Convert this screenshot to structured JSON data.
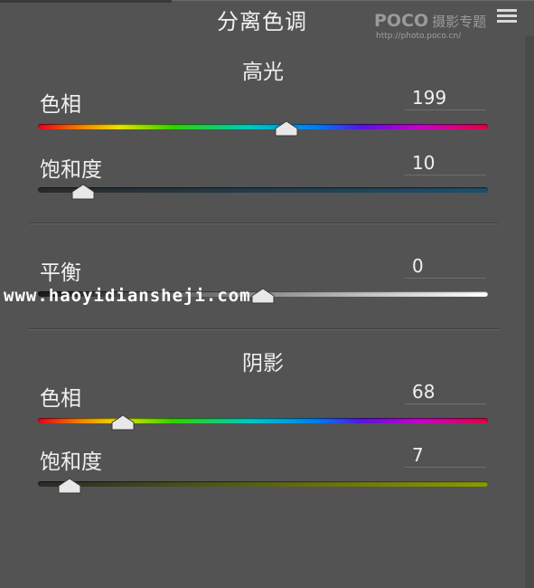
{
  "panel": {
    "title": "分离色调"
  },
  "watermark": {
    "brand": "POCO",
    "brand_sub": "摄影专题",
    "url": "http://photo.poco.cn/",
    "site": "www.haoyidiansheji.com"
  },
  "highlights": {
    "title": "高光",
    "hue": {
      "label": "色相",
      "value": "199",
      "fraction": 0.553
    },
    "saturation": {
      "label": "饱和度",
      "value": "10",
      "fraction": 0.1
    }
  },
  "balance": {
    "label": "平衡",
    "value": "0",
    "fraction": 0.5
  },
  "shadows": {
    "title": "阴影",
    "hue": {
      "label": "色相",
      "value": "68",
      "fraction": 0.189
    },
    "saturation": {
      "label": "饱和度",
      "value": "7",
      "fraction": 0.07
    }
  }
}
